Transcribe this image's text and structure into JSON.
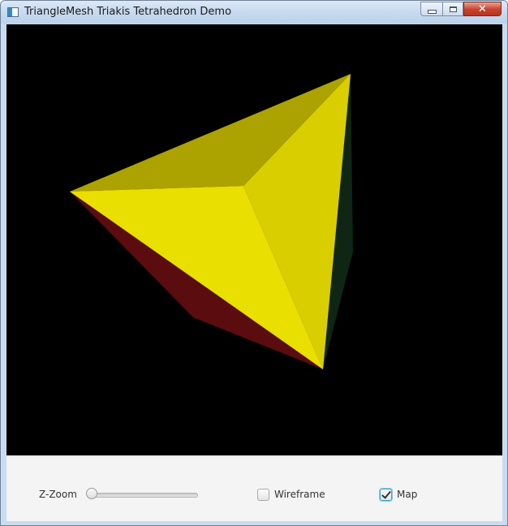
{
  "window": {
    "title": "TriangleMesh Triakis Tetrahedron Demo",
    "close_glyph": "✕"
  },
  "controls": {
    "zoom_label": "Z-Zoom",
    "zoom_value": 0.0,
    "wireframe_label": "Wireframe",
    "wireframe_checked": false,
    "map_label": "Map",
    "map_checked": true
  },
  "scene": {
    "background": "#000000",
    "face_colors": [
      "#aca200",
      "#d9cf00",
      "#e9df00",
      "#5a0c0f",
      "#0e2613"
    ]
  }
}
